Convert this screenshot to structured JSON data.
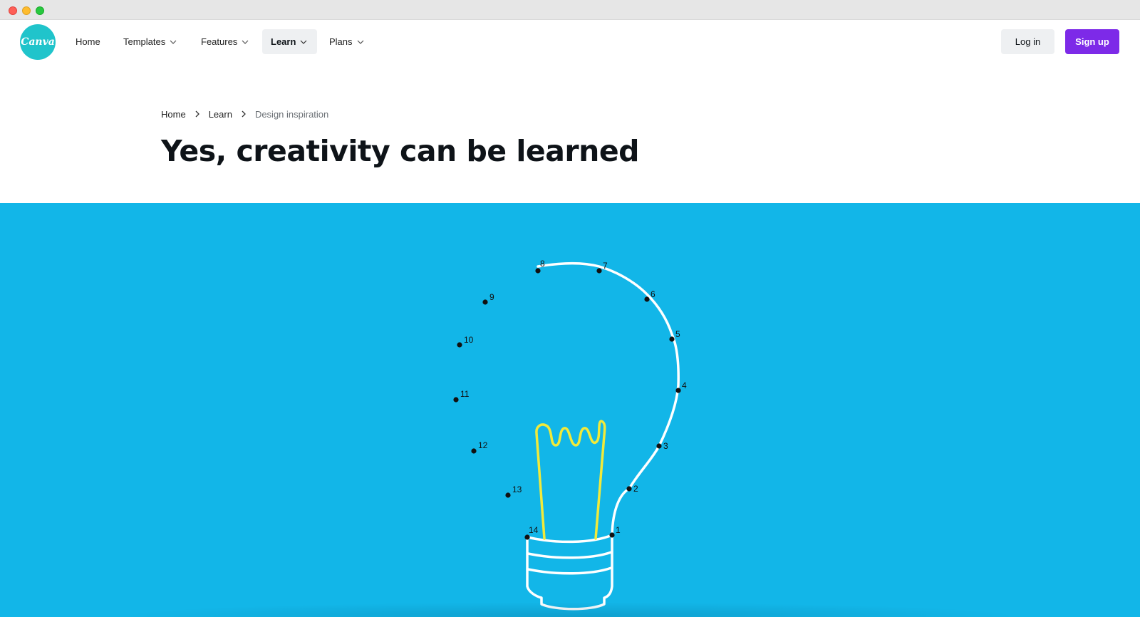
{
  "brand": {
    "logo_text": "Canva",
    "logo_color": "#20c4cb"
  },
  "nav": {
    "items": [
      {
        "label": "Home",
        "has_dropdown": false
      },
      {
        "label": "Templates",
        "has_dropdown": true
      },
      {
        "label": "Features",
        "has_dropdown": true
      },
      {
        "label": "Learn",
        "has_dropdown": true,
        "active": true
      },
      {
        "label": "Plans",
        "has_dropdown": true
      }
    ],
    "login_label": "Log in",
    "signup_label": "Sign up",
    "signup_color": "#7d2ae8"
  },
  "breadcrumb": {
    "items": [
      "Home",
      "Learn"
    ],
    "current": "Design inspiration"
  },
  "page": {
    "title": "Yes, creativity can be learned"
  },
  "hero": {
    "background_color": "#12b6e8",
    "filament_color": "#f1ea3a",
    "dot_labels": [
      "1",
      "2",
      "3",
      "4",
      "5",
      "6",
      "7",
      "8",
      "9",
      "10",
      "11",
      "12",
      "13",
      "14"
    ]
  }
}
